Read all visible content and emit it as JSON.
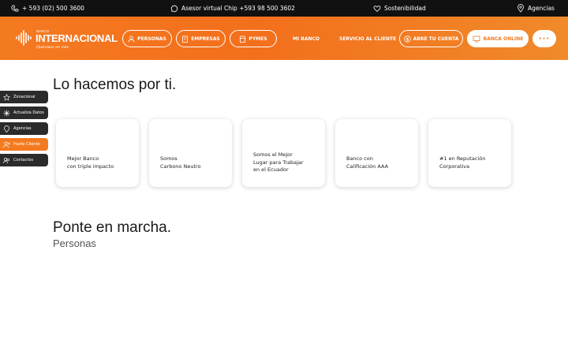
{
  "topbar": {
    "phone": "+ 593 (02) 500 3600",
    "assistant": "Asesor virtual Chip +593 98 500 3602",
    "sustainability": "Sostenibilidad",
    "branches": "Agencias"
  },
  "logo": {
    "small": "BANCO",
    "big": "INTERNACIONAL",
    "tagline": "Queremos ser más"
  },
  "nav": {
    "personas": "PERSONAS",
    "empresas": "EMPRESAS",
    "pymes": "PYMES",
    "mi_banco": "MI BANCO",
    "servicio": "SERVICIO AL CLIENTE",
    "abre_cuenta": "ABRE TU CUENTA",
    "banca_online": "BANCA ONLINE",
    "more": "···"
  },
  "sidebar": {
    "items": [
      {
        "label": "Zonacional",
        "icon": "star-icon"
      },
      {
        "label": "Actualiza Datos",
        "icon": "sparkle-icon"
      },
      {
        "label": "Agencias",
        "icon": "location-icon"
      },
      {
        "label": "Hazte Cliente",
        "icon": "user-add-icon"
      },
      {
        "label": "Contactos",
        "icon": "contacts-icon"
      }
    ]
  },
  "section1": {
    "title": "Lo hacemos por ti.",
    "cards": [
      "Mejor Banco\ncon triple impacto",
      "Somos\nCarbono Neutro",
      "Somos el Mejor\nLugar para Trabajar\nen el Ecuador",
      "Banco con\nCalificación AAA",
      "#1 en Reputación\nCorporativa"
    ]
  },
  "section2": {
    "title": "Ponte en marcha.",
    "subtitle": "Personas"
  },
  "colors": {
    "brand_orange": "#f47a20",
    "topbar": "#111111",
    "sidebar": "#2b2b2b"
  }
}
